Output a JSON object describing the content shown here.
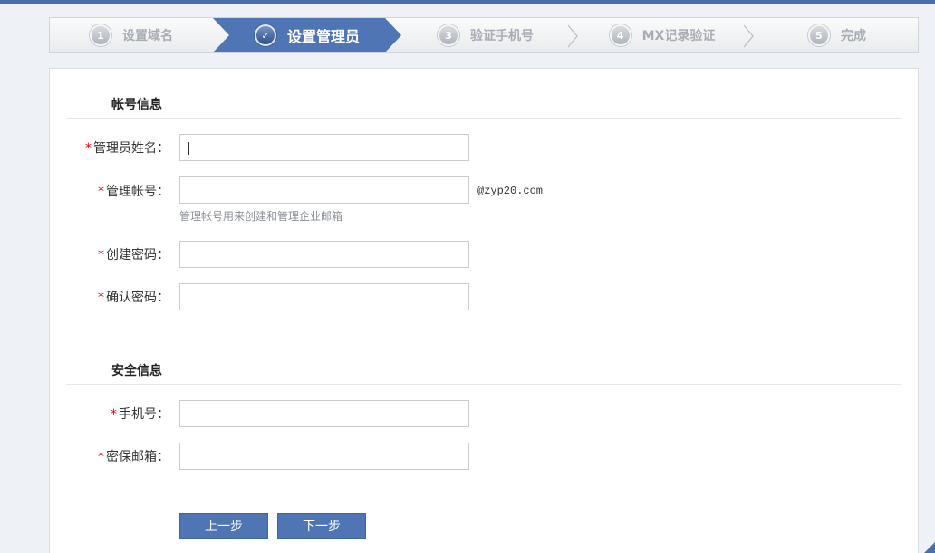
{
  "steps": [
    {
      "num": "1",
      "label": "设置域名"
    },
    {
      "num": "✓",
      "label": "设置管理员"
    },
    {
      "num": "3",
      "label": "验证手机号"
    },
    {
      "num": "4",
      "label": "MX记录验证"
    },
    {
      "num": "5",
      "label": "完成"
    }
  ],
  "account_section": {
    "title": "帐号信息",
    "admin_name": {
      "required": "*",
      "label": "管理员姓名：",
      "value": ""
    },
    "admin_account": {
      "required": "*",
      "label": "管理帐号：",
      "value": "",
      "suffix": "@zyp20.com",
      "hint": "管理帐号用来创建和管理企业邮箱"
    },
    "password": {
      "required": "*",
      "label": "创建密码：",
      "value": ""
    },
    "confirm_password": {
      "required": "*",
      "label": "确认密码：",
      "value": ""
    }
  },
  "security_section": {
    "title": "安全信息",
    "phone": {
      "required": "*",
      "label": "手机号：",
      "value": ""
    },
    "backup_email": {
      "required": "*",
      "label": "密保邮箱：",
      "value": ""
    }
  },
  "buttons": {
    "prev": "上一步",
    "next": "下一步"
  },
  "colors": {
    "accent": "#4f75b5",
    "required": "#d9000d"
  }
}
